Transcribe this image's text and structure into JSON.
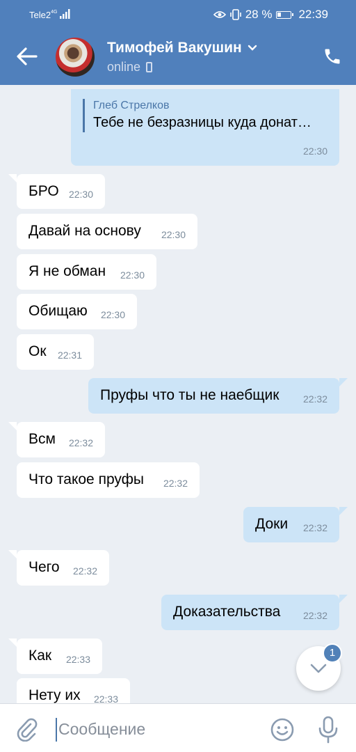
{
  "status_bar": {
    "carrier": "Tele2",
    "network": "4G",
    "battery_percent": "28 %",
    "time": "22:39"
  },
  "header": {
    "contact_name": "Тимофей Вакушин",
    "presence": "online",
    "icons": [
      "back-arrow-icon",
      "chevron-down-icon",
      "mobile-phone-icon",
      "call-icon"
    ],
    "accent_color": "#5080bc"
  },
  "messages": [
    {
      "dir": "out",
      "quote_author": "Глеб Стрелков",
      "quote_text": "Тебе не безразницы куда донат…",
      "text": "",
      "time": "22:30"
    },
    {
      "dir": "in",
      "text": "БРО",
      "time": "22:30"
    },
    {
      "dir": "in",
      "text": "Давай на основу",
      "time": "22:30"
    },
    {
      "dir": "in",
      "text": "Я не обман",
      "time": "22:30"
    },
    {
      "dir": "in",
      "text": "Обищаю",
      "time": "22:30"
    },
    {
      "dir": "in",
      "text": "Ок",
      "time": "22:31"
    },
    {
      "dir": "out",
      "text": "Пруфы что ты не наебщик",
      "time": "22:32"
    },
    {
      "dir": "in",
      "text": "Всм",
      "time": "22:32"
    },
    {
      "dir": "in",
      "text": "Что такое пруфы",
      "time": "22:32"
    },
    {
      "dir": "out",
      "text": "Доки",
      "time": "22:32"
    },
    {
      "dir": "in",
      "text": "Чего",
      "time": "22:32"
    },
    {
      "dir": "out",
      "text": "Доказательства",
      "time": "22:32"
    },
    {
      "dir": "in",
      "text": "Как",
      "time": "22:33"
    },
    {
      "dir": "in",
      "text": "Нету их",
      "time": "22:33"
    }
  ],
  "scroll_down": {
    "badge": "1"
  },
  "composer": {
    "placeholder": "Сообщение",
    "icons": [
      "paperclip-icon",
      "emoji-icon",
      "microphone-icon"
    ]
  },
  "colors": {
    "incoming_bubble": "#ffffff",
    "outgoing_bubble": "#cce4f7",
    "chat_background": "#ebeff4"
  }
}
